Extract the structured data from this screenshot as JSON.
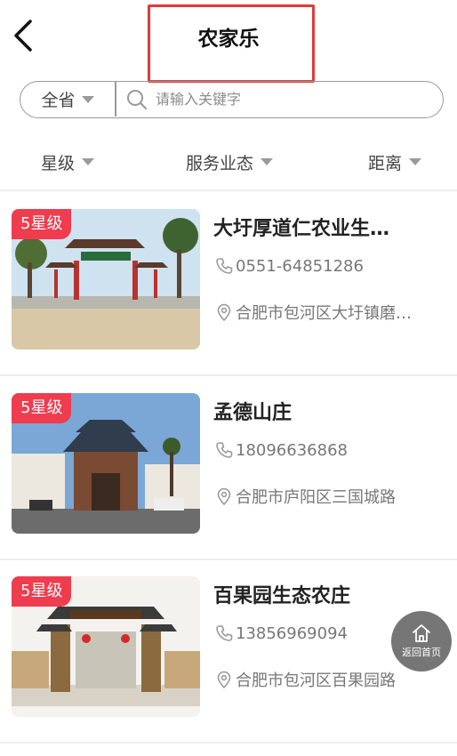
{
  "header": {
    "title": "农家乐",
    "back_icon": "chevron-left-icon"
  },
  "search": {
    "scope": "全省",
    "placeholder": "请输入关键字",
    "value": ""
  },
  "filters": [
    {
      "label": "星级"
    },
    {
      "label": "服务业态"
    },
    {
      "label": "距离"
    }
  ],
  "items": [
    {
      "badge": "5星级",
      "name": "大圩厚道仁农业生…",
      "phone": "0551-64851286",
      "address": "合肥市包河区大圩镇磨…"
    },
    {
      "badge": "5星级",
      "name": "孟德山庄",
      "phone": "18096636868",
      "address": "合肥市庐阳区三国城路"
    },
    {
      "badge": "5星级",
      "name": "百果园生态农庄",
      "phone": "13856969094",
      "address": "合肥市包河区百果园路"
    }
  ],
  "floating": {
    "home_label": "返回首页",
    "icon": "home-icon"
  },
  "colors": {
    "badge": "#ef3c4f",
    "highlight_box": "#e03a3a",
    "float_btn": "#6f6f6f"
  }
}
